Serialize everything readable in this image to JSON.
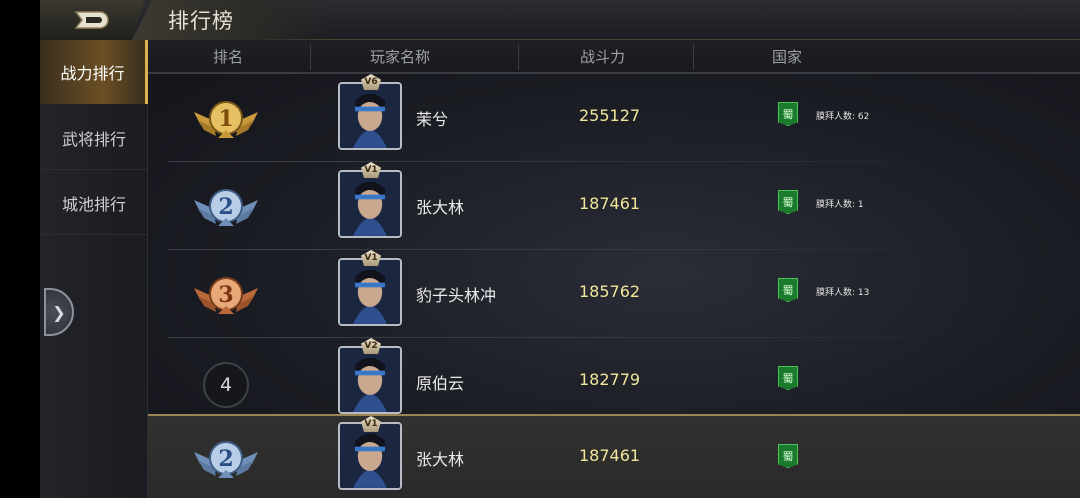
{
  "header": {
    "title": "排行榜"
  },
  "sidebar": {
    "items": [
      {
        "label": "战力排行",
        "active": true
      },
      {
        "label": "武将排行",
        "active": false
      },
      {
        "label": "城池排行",
        "active": false
      }
    ]
  },
  "columns": {
    "rank": "排名",
    "name": "玩家名称",
    "power": "战斗力",
    "nation": "国家"
  },
  "rows": [
    {
      "rank": "1",
      "vip": "V6",
      "name": "茉兮",
      "power": "255127",
      "nation": "蜀",
      "worship": "膜拜人数: 62"
    },
    {
      "rank": "2",
      "vip": "V1",
      "name": "张大林",
      "power": "187461",
      "nation": "蜀",
      "worship": "膜拜人数: 1"
    },
    {
      "rank": "3",
      "vip": "V1",
      "name": "豹子头林冲",
      "power": "185762",
      "nation": "蜀",
      "worship": "膜拜人数: 13"
    },
    {
      "rank": "4",
      "vip": "V2",
      "name": "原伯云",
      "power": "182779",
      "nation": "蜀",
      "worship": ""
    }
  ],
  "self": {
    "rank": "2",
    "vip": "V1",
    "name": "张大林",
    "power": "187461",
    "nation": "蜀"
  },
  "colors": {
    "gold": "#e0b050",
    "silver": "#9fb8d8",
    "bronze": "#d08a5a",
    "power": "#f1e69a",
    "nation_green": "#1b7a2c"
  }
}
